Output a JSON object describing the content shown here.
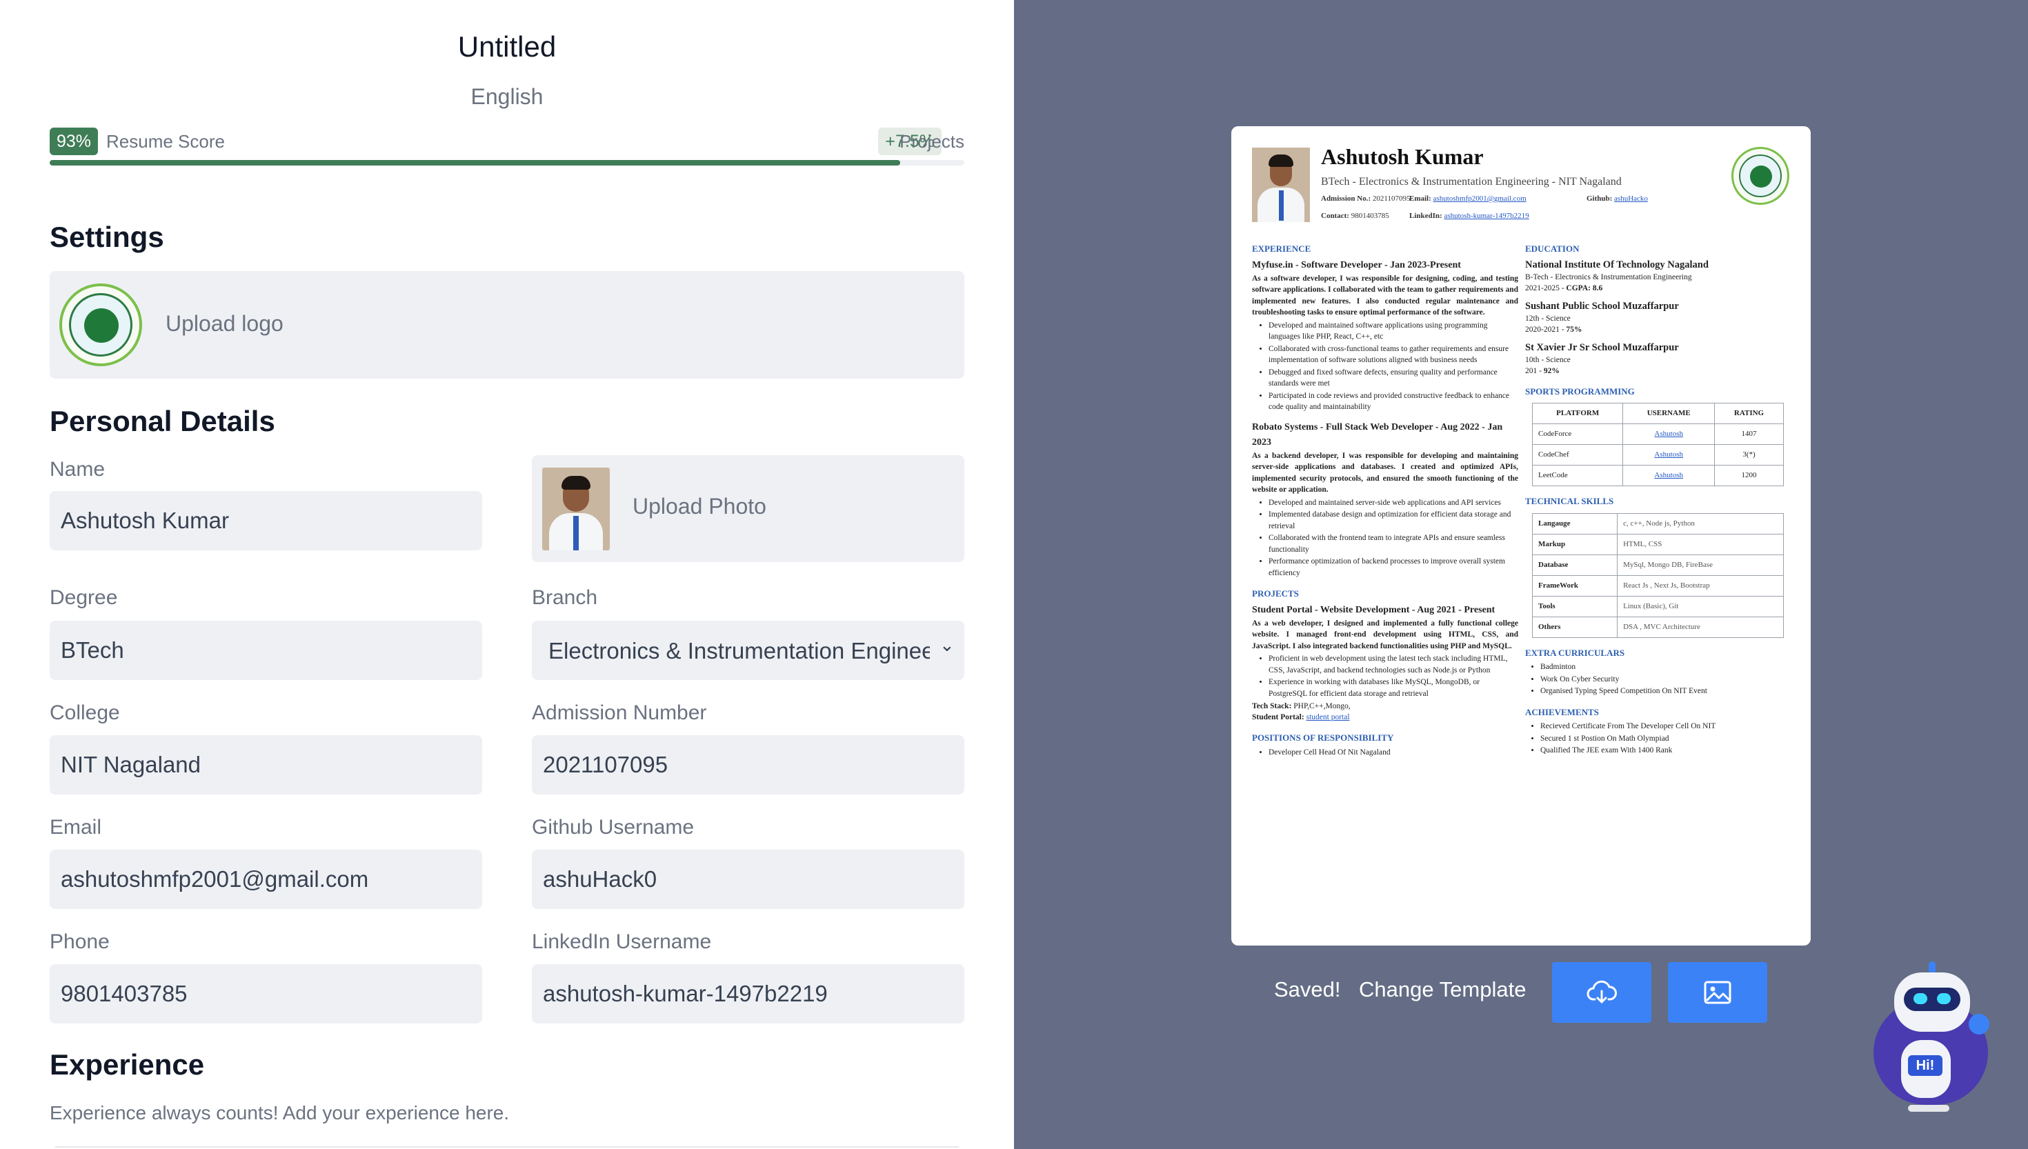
{
  "editor": {
    "title": "Untitled",
    "language": "English",
    "score": {
      "value": "93%",
      "label": "Resume Score",
      "fraction": 0.93
    },
    "projects": {
      "value": "+7.5%",
      "label": "Projects"
    },
    "settings": {
      "heading": "Settings",
      "upload_logo": "Upload logo"
    },
    "personal": {
      "heading": "Personal Details",
      "upload_photo": "Upload Photo",
      "name": {
        "label": "Name",
        "value": "Ashutosh Kumar"
      },
      "degree": {
        "label": "Degree",
        "value": "BTech"
      },
      "branch": {
        "label": "Branch",
        "value": "Electronics & Instrumentation Engineering"
      },
      "college": {
        "label": "College",
        "value": "NIT Nagaland"
      },
      "admission": {
        "label": "Admission Number",
        "value": "2021107095"
      },
      "email": {
        "label": "Email",
        "value": "ashutoshmfp2001@gmail.com"
      },
      "github": {
        "label": "Github Username",
        "value": "ashuHack0"
      },
      "phone": {
        "label": "Phone",
        "value": "9801403785"
      },
      "linkedin": {
        "label": "LinkedIn Username",
        "value": "ashutosh-kumar-1497b2219"
      }
    },
    "experience": {
      "heading": "Experience",
      "subtitle": "Experience always counts! Add your experience here."
    }
  },
  "resume": {
    "name": "Ashutosh Kumar",
    "subtitle": "BTech - Electronics & Instrumentation Engineering - NIT Nagaland",
    "admission_label": "Admission No.:",
    "admission": "2021107095",
    "email_label": "Email:",
    "email": "ashutoshmfp2001@gmail.com",
    "github_label": "Github:",
    "github": "ashuHacko",
    "contact_label": "Contact:",
    "contact": "9801403785",
    "linkedin_label": "LinkedIn:",
    "linkedin": "ashutosh-kumar-1497b2219",
    "sections": {
      "experience": "EXPERIENCE",
      "projects": "PROJECTS",
      "positions": "POSITIONS OF RESPONSIBILITY",
      "education": "EDUCATION",
      "sports": "SPORTS PROGRAMMING",
      "skills": "TECHNICAL SKILLS",
      "extra": "EXTRA CURRICULARS",
      "achievements": "ACHIEVEMENTS"
    },
    "experience": [
      {
        "title": "Myfuse.in - Software Developer - Jan 2023-Present",
        "summary": "As a software developer, I was responsible for designing, coding, and testing software applications. I collaborated with the team to gather requirements and implemented new features. I also conducted regular maintenance and troubleshooting tasks to ensure optimal performance of the software.",
        "bullets": [
          "Developed and maintained software applications using programming languages like PHP, React, C++, etc",
          "Collaborated with cross-functional teams to gather requirements and ensure implementation of software solutions aligned with business needs",
          "Debugged and fixed software defects, ensuring quality and performance standards were met",
          "Participated in code reviews and provided constructive feedback to enhance code quality and maintainability"
        ]
      },
      {
        "title": "Robato Systems - Full Stack Web Developer - Aug 2022 - Jan 2023",
        "summary": "As a backend developer, I was responsible for developing and maintaining server-side applications and databases. I created and optimized APIs, implemented security protocols, and ensured the smooth functioning of the website or application.",
        "bullets": [
          "Developed and maintained server-side web applications and API services",
          "Implemented database design and optimization for efficient data storage and retrieval",
          "Collaborated with the frontend team to integrate APIs and ensure seamless functionality",
          "Performance optimization of backend processes to improve overall system efficiency"
        ]
      }
    ],
    "project": {
      "title": "Student Portal - Website Development - Aug 2021 - Present",
      "summary": "As a web developer, I designed and implemented a fully functional college website. I managed front-end development using HTML, CSS, and JavaScript. I also integrated backend functionalities using PHP and MySQL.",
      "bullets": [
        "Proficient in web development using the latest tech stack including HTML, CSS, JavaScript, and backend technologies such as Node.js or Python",
        "Experience in working with databases like MySQL, MongoDB, or PostgreSQL for efficient data storage and retrieval"
      ],
      "stack_label": "Tech Stack:",
      "stack": "PHP,C++,Mongo,",
      "portal_label": "Student Portal:",
      "portal_link": "student portal"
    },
    "positions": [
      "Developer Cell Head Of Nit Nagaland"
    ],
    "education": [
      {
        "name": "National Institute Of Technology Nagaland",
        "line1": "B-Tech - Electronics & Instrumentation Engineering",
        "line2": "2021-2025 - ",
        "score": "CGPA: 8.6"
      },
      {
        "name": "Sushant Public School Muzaffarpur",
        "line1": "12th - Science",
        "line2": "2020-2021 - ",
        "score": "75%"
      },
      {
        "name": "St Xavier Jr Sr School Muzaffarpur",
        "line1": "10th - Science",
        "line2": "201 - ",
        "score": "92%"
      }
    ],
    "sports_table": {
      "headers": [
        "PLATFORM",
        "USERNAME",
        "RATING"
      ],
      "rows": [
        [
          "CodeForce",
          "Ashutosh",
          "1407"
        ],
        [
          "CodeChef",
          "Ashutosh",
          "3(*)"
        ],
        [
          "LeetCode",
          "Ashutosh",
          "1200"
        ]
      ]
    },
    "skills": [
      [
        "Langauge",
        "c, c++, Node js, Python"
      ],
      [
        "Markup",
        "HTML, CSS"
      ],
      [
        "Database",
        "MySql, Mongo DB, FireBase"
      ],
      [
        "FrameWork",
        "React Js , Next Js, Bootstrap"
      ],
      [
        "Tools",
        "Linux (Basic), Git"
      ],
      [
        "Others",
        "DSA , MVC Architecture"
      ]
    ],
    "extra": [
      "Badminton",
      "Work On Cyber Security",
      "Organised Typing Speed Competition On NIT Event"
    ],
    "achievements": [
      "Recieved Certificate From The Developer Cell On NIT",
      "Secured 1 st Postion On Math Olympiad",
      "Qualified The JEE exam With 1400 Rank"
    ]
  },
  "actions": {
    "saved": "Saved!",
    "change_template": "Change Template",
    "download_icon": "cloud-download-icon",
    "image_icon": "image-icon"
  },
  "chatbot": {
    "badge": "Hi!",
    "icon": "robot-assistant-icon"
  },
  "colors": {
    "accent_green": "#3f7d57",
    "preview_bg": "#646d85",
    "button_blue": "#3b82f6",
    "resume_section": "#2d5fb0"
  }
}
